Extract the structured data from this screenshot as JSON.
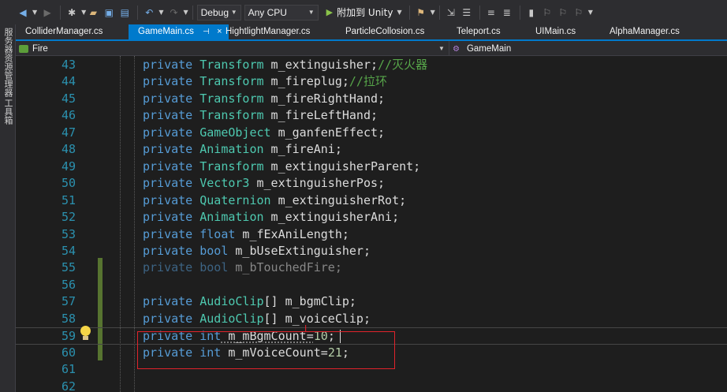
{
  "toolbar": {
    "config": "Debug",
    "platform": "Any CPU",
    "attach_label": "附加到 Unity"
  },
  "side_tabs": [
    "服务器资源管理器",
    "工具箱"
  ],
  "tabs": [
    {
      "label": "ColliderManager.cs",
      "active": false
    },
    {
      "label": "GameMain.cs",
      "active": true
    },
    {
      "label": "HightlightManager.cs",
      "active": false
    },
    {
      "label": "ParticleCollosion.cs",
      "active": false
    },
    {
      "label": "Teleport.cs",
      "active": false
    },
    {
      "label": "UIMain.cs",
      "active": false
    },
    {
      "label": "AlphaManager.cs",
      "active": false
    }
  ],
  "tab_icons": {
    "pin": "⊣",
    "close": "×"
  },
  "nav": {
    "left": "Fire",
    "right": "GameMain"
  },
  "editor": {
    "lines": [
      {
        "num": "43",
        "kw": "private",
        "type": "Transform",
        "rest": " m_extinguisher;",
        "comment": "//灭火器"
      },
      {
        "num": "44",
        "kw": "private",
        "type": "Transform",
        "rest": " m_fireplug;",
        "comment": "//拉环"
      },
      {
        "num": "45",
        "kw": "private",
        "type": "Transform",
        "rest": " m_fireRightHand;",
        "comment": ""
      },
      {
        "num": "46",
        "kw": "private",
        "type": "Transform",
        "rest": " m_fireLeftHand;",
        "comment": ""
      },
      {
        "num": "47",
        "kw": "private",
        "type": "GameObject",
        "rest": " m_ganfenEffect;",
        "comment": ""
      },
      {
        "num": "48",
        "kw": "private",
        "type": "Animation",
        "rest": " m_fireAni;",
        "comment": ""
      },
      {
        "num": "49",
        "kw": "private",
        "type": "Transform",
        "rest": " m_extinguisherParent;",
        "comment": ""
      },
      {
        "num": "50",
        "kw": "private",
        "type": "Vector3",
        "rest": " m_extinguisherPos;",
        "comment": ""
      },
      {
        "num": "51",
        "kw": "private",
        "type": "Quaternion",
        "rest": " m_extinguisherRot;",
        "comment": ""
      },
      {
        "num": "52",
        "kw": "private",
        "type": "Animation",
        "rest": " m_extinguisherAni;",
        "comment": ""
      },
      {
        "num": "53",
        "kw": "private",
        "type": "float",
        "rest": " m_fExAniLength;",
        "comment": ""
      },
      {
        "num": "54",
        "kw": "private",
        "type": "bool",
        "rest": " m_bUseExtinguisher;",
        "comment": ""
      },
      {
        "num": "55",
        "kw": "private",
        "type": "bool",
        "rest": " m_bTouchedFire;",
        "comment": ""
      },
      {
        "num": "56",
        "kw": "",
        "type": "",
        "rest": "",
        "comment": ""
      },
      {
        "num": "57",
        "kw": "private",
        "type": "AudioClip",
        "rest": "[] m_bgmClip;",
        "comment": ""
      },
      {
        "num": "58",
        "kw": "private",
        "type": "AudioClip",
        "rest": "[] m_voiceClip;",
        "comment": ""
      },
      {
        "num": "59",
        "kw": "private",
        "type": "int",
        "rest": " m_mBgmCount=",
        "num_val": "10",
        "tail": ";",
        "comment": ""
      },
      {
        "num": "60",
        "kw": "private",
        "type": "int",
        "rest": " m_mVoiceCount=",
        "num_val": "21",
        "tail": ";",
        "comment": ""
      },
      {
        "num": "61",
        "kw": "",
        "type": "",
        "rest": "",
        "comment": ""
      },
      {
        "num": "62",
        "kw": "",
        "type": "",
        "rest": "",
        "comment": ""
      }
    ]
  },
  "colors": {
    "keyword": "#569cd6",
    "type": "#4ec9b0",
    "comment": "#57a64a",
    "number": "#b5cea8",
    "line_number": "#2b91af",
    "accent": "#007acc",
    "annotation_box": "#e0232b"
  }
}
